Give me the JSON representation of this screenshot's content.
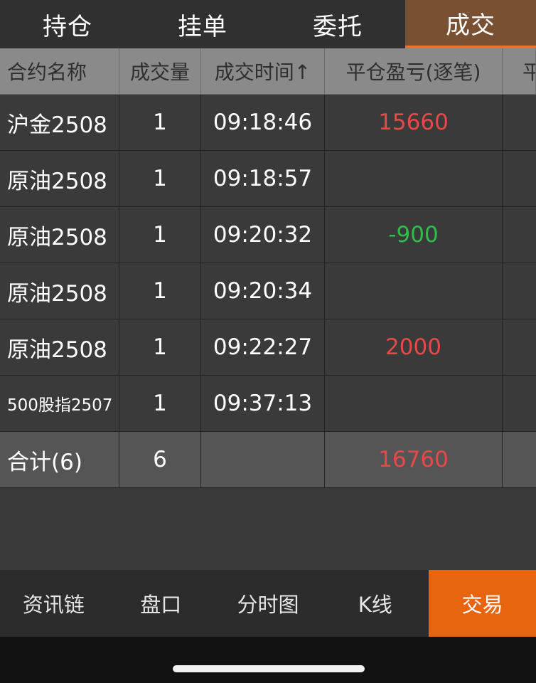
{
  "top_tabs": [
    "持仓",
    "挂单",
    "委托",
    "成交"
  ],
  "table": {
    "headers": [
      "合约名称",
      "成交量",
      "成交时间↑",
      "平仓盈亏(逐笔)",
      "平"
    ],
    "rows": [
      {
        "name": "沪金2508",
        "qty": "1",
        "time": "09:18:46",
        "pnl": "15660"
      },
      {
        "name": "原油2508",
        "qty": "1",
        "time": "09:18:57",
        "pnl": ""
      },
      {
        "name": "原油2508",
        "qty": "1",
        "time": "09:20:32",
        "pnl": "-900"
      },
      {
        "name": "原油2508",
        "qty": "1",
        "time": "09:20:34",
        "pnl": ""
      },
      {
        "name": "原油2508",
        "qty": "1",
        "time": "09:22:27",
        "pnl": "2000"
      },
      {
        "name": "500股指2507",
        "qty": "1",
        "time": "09:37:13",
        "pnl": ""
      }
    ],
    "total": {
      "name": "合计(6)",
      "qty": "6",
      "time": "",
      "pnl": "16760"
    }
  },
  "bottom_nav": [
    "资讯链",
    "盘口",
    "分时图",
    "K线",
    "交易"
  ],
  "colors": {
    "accent": "#e8650f",
    "profit": "#e84848",
    "loss": "#2fbd4c"
  }
}
